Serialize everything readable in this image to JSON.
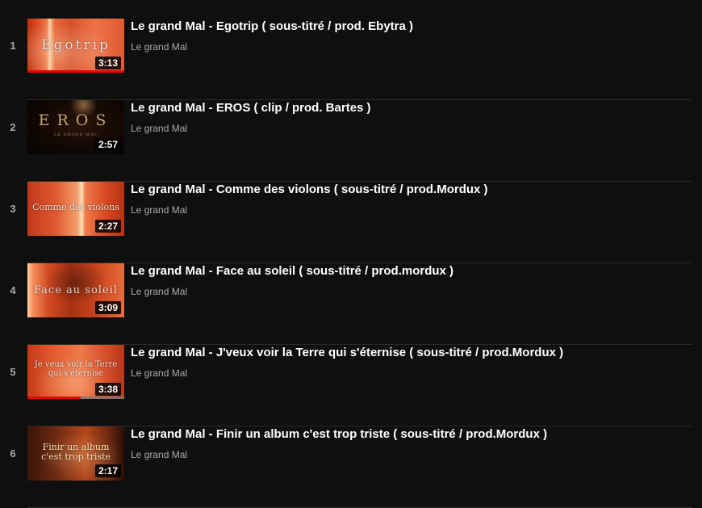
{
  "playlist": {
    "items": [
      {
        "index": "1",
        "title": "Le grand Mal - Egotrip ( sous-titré / prod. Ebytra )",
        "channel": "Le grand Mal",
        "duration": "3:13",
        "thumb_text": "Egotrip",
        "watched_fraction": 1.0
      },
      {
        "index": "2",
        "title": "Le grand Mal - EROS ( clip / prod. Bartes )",
        "channel": "Le grand Mal",
        "duration": "2:57",
        "thumb_text": "EROS",
        "thumb_subtext": "LE GRAND MAL",
        "watched_fraction": 0
      },
      {
        "index": "3",
        "title": "Le grand Mal - Comme des violons ( sous-titré / prod.Mordux )",
        "channel": "Le grand Mal",
        "duration": "2:27",
        "thumb_text": "Comme des violons",
        "watched_fraction": 0
      },
      {
        "index": "4",
        "title": "Le grand Mal - Face au soleil ( sous-titré / prod.mordux )",
        "channel": "Le grand Mal",
        "duration": "3:09",
        "thumb_text": "Face au soleil",
        "watched_fraction": 0
      },
      {
        "index": "5",
        "title": "Le grand Mal - J'veux voir la Terre qui s'éternise ( sous-titré / prod.Mordux )",
        "channel": "Le grand Mal",
        "duration": "3:38",
        "thumb_text": "Je veux voir la Terre qui s'éternise",
        "watched_fraction": 0.55
      },
      {
        "index": "6",
        "title": "Le grand Mal - Finir un album c'est trop triste ( sous-titré / prod.Mordux )",
        "channel": "Le grand Mal",
        "duration": "2:17",
        "thumb_text": "Finir un album c'est trop triste",
        "watched_fraction": 0
      }
    ]
  },
  "colors": {
    "background": "#0f0f0f",
    "progress": "#ee0000",
    "title": "#ffffff",
    "secondary": "#aaaaaa"
  }
}
